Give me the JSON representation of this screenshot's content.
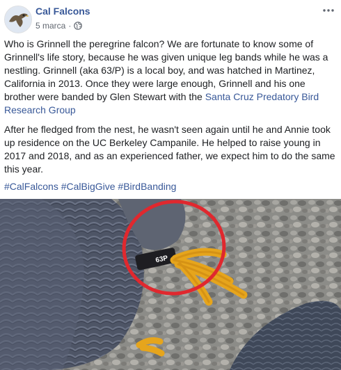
{
  "post": {
    "author": "Cal Falcons",
    "date": "5 marca",
    "separator": "·",
    "icons": {
      "privacy": "globe-icon",
      "options": "more-horizontal-icon",
      "avatar": "falcon-avatar"
    },
    "paragraph1": {
      "text": "Who is Grinnell the peregrine falcon? We are fortunate to know some of Grinnell's life story, because he was given unique leg bands while he was a nestling. Grinnell (aka 63/P) is a local boy, and was hatched in Martinez, California in 2013. Once they were large enough, Grinnell and his one brother were banded by Glen Stewart with the ",
      "link": "Santa Cruz Predatory Bird Research Group"
    },
    "paragraph2": "After he fledged from the nest, he wasn't seen again until he and Annie took up residence on the UC Berkeley Campanile. He helped to raise young in 2017 and 2018, and as an experienced father, we expect him to do the same this year.",
    "hashtags": [
      "#CalFalcons",
      "#CalBigGive",
      "#BirdBanding"
    ],
    "photo": {
      "band_text": "63P",
      "accent_circle_color": "#e0282e",
      "feet_color": "#e6a51c"
    }
  }
}
